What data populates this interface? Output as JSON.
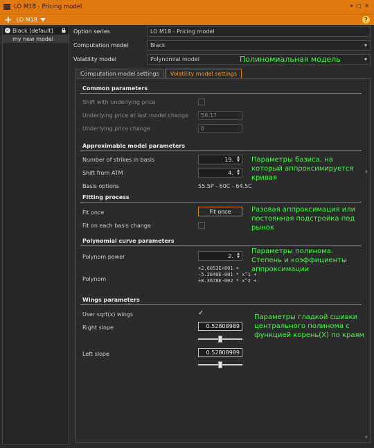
{
  "window": {
    "title": "LO M18 - Pricing model",
    "controls": "▾ □ ✕"
  },
  "toolbar": {
    "add": "+",
    "model_name": "LO M18",
    "help": "?"
  },
  "sidebar": {
    "items": [
      {
        "label": "Black [default]"
      },
      {
        "label": "my new model"
      }
    ]
  },
  "props": {
    "option_series_label": "Option series",
    "option_series_value": "LO M18 - Pricing model",
    "computation_model_label": "Computation model",
    "computation_model_value": "Black",
    "volatility_model_label": "Volatility model",
    "volatility_model_value": "Polynomial model"
  },
  "tabs": [
    {
      "label": "Computation model settings"
    },
    {
      "label": "Volatility model settings"
    }
  ],
  "common": {
    "title": "Common parameters",
    "shift_label": "Shift with underlying price",
    "under_price_label": "Underlying price at last model change",
    "under_price_value": "58.17",
    "under_change_label": "Underlying price change",
    "under_change_value": "0"
  },
  "approx": {
    "title": "Approximable model parameters",
    "strikes_label": "Number of strikes in basis",
    "strikes_value": "19.",
    "shift_label": "Shift from ATM",
    "shift_value": "4.",
    "basis_label": "Basis options",
    "basis_value": "55.5P - 60C - 64.5C"
  },
  "fitting": {
    "title": "Fitting process",
    "fit_once_label": "Fit once",
    "fit_once_button": "Fit once",
    "fit_each_label": "Fit on each basis change"
  },
  "poly": {
    "title": "Polynomial curve parameters",
    "power_label": "Polynom power",
    "power_value": "2.",
    "polynom_label": "Polynom",
    "line1": "+2.6053E+001 +",
    "line2": "-5.2640E-001 * x^1 +",
    "line3": "+8.3678E-002 * x^2 +"
  },
  "wings": {
    "title": "Wings parameters",
    "sqrt_label": "User sqrt(x) wings",
    "right_label": "Right slope",
    "right_value": "0.52808989",
    "right_slider_fraction": 0.5,
    "left_label": "Left slope",
    "left_value": "0.52808989",
    "left_slider_fraction": 0.5
  },
  "annotations": {
    "a1": "Полиномиальная модель",
    "a2_l1": "Параметры базиса, на",
    "a2_l2": "который аппроксимируется",
    "a2_l3": "кривая",
    "a3_l1": "Разовая аппроксимация или",
    "a3_l2": "постоянная подстройка под",
    "a3_l3": "рынок",
    "a4_l1": "Параметры полинома.",
    "a4_l2": "Степень и коэффициенты",
    "a4_l3": "аппроксимации",
    "a5_l1": "Параметры гладкой сшивки",
    "a5_l2": "центрального полинома с",
    "a5_l3": "функцией корень(X) по краям"
  },
  "colors": {
    "accent": "#e07a10",
    "annotation": "#3cff3c"
  }
}
